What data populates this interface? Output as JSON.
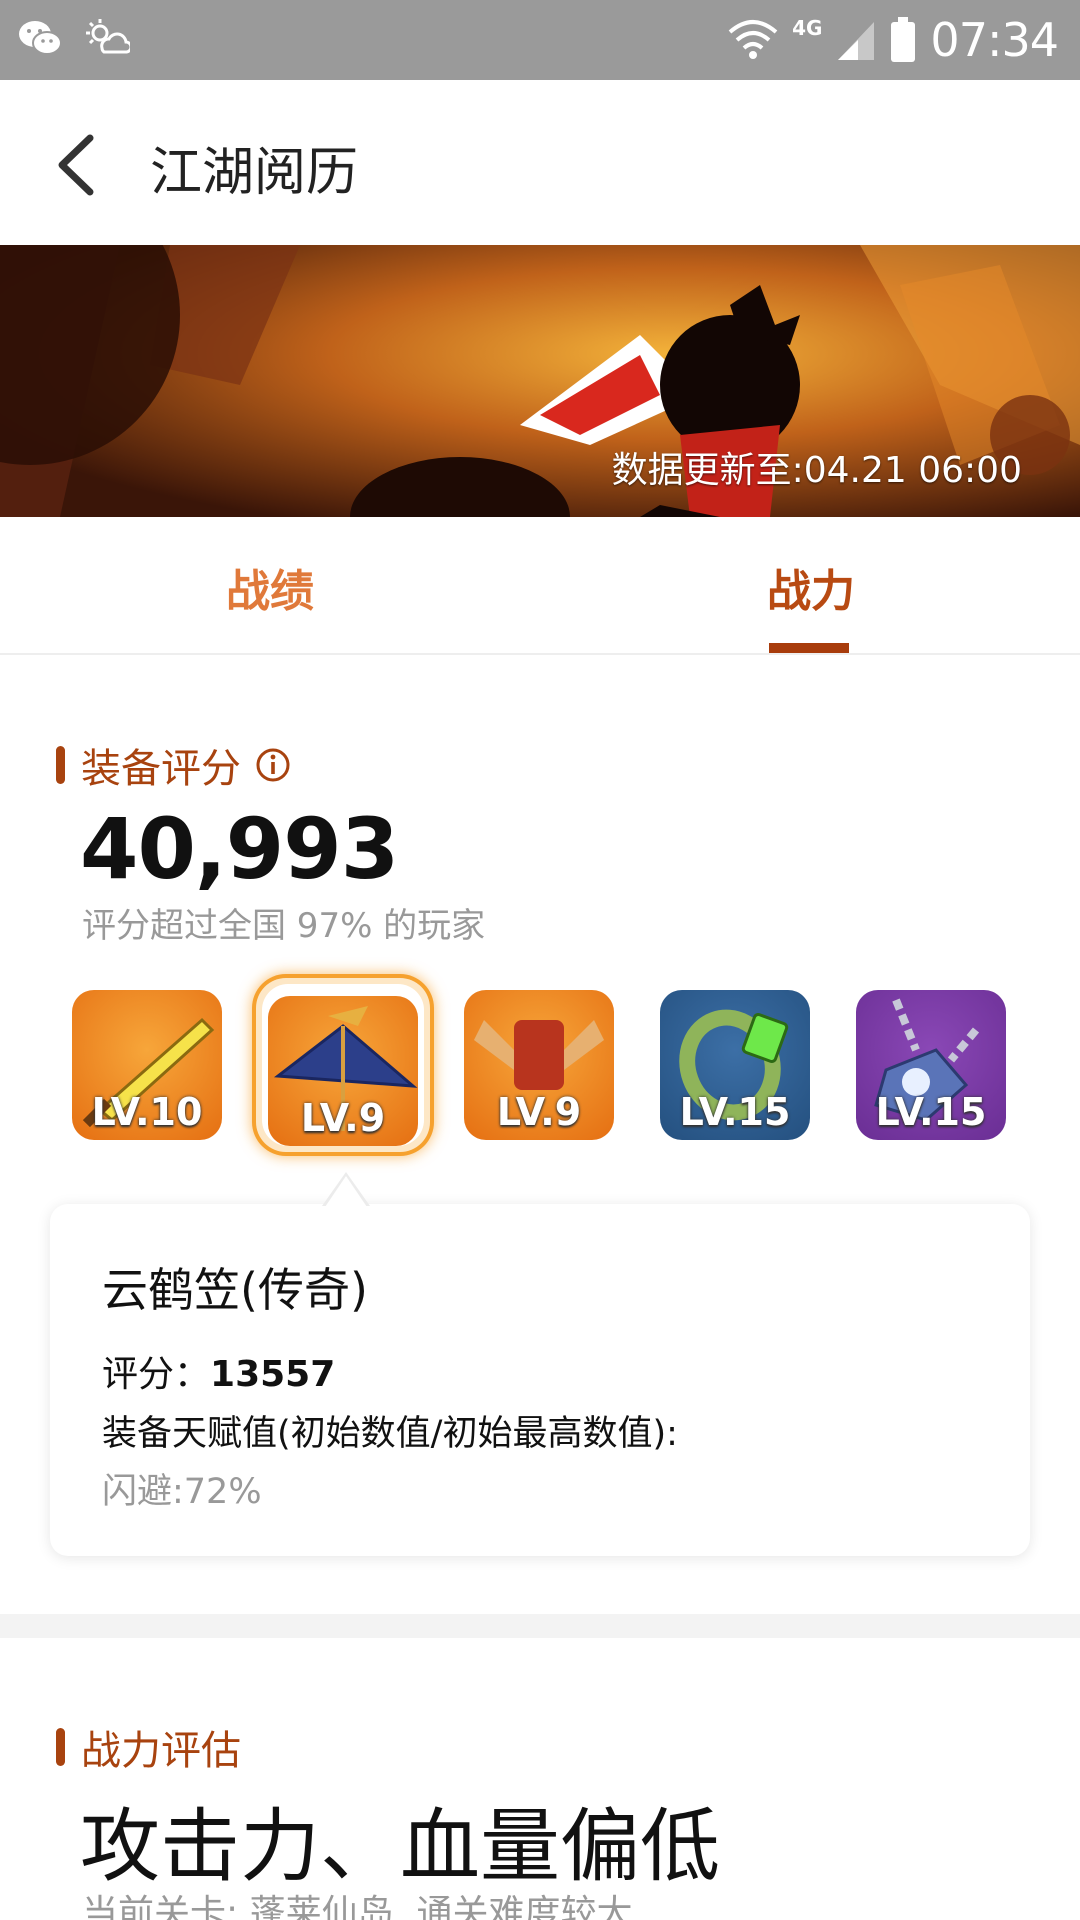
{
  "status_bar": {
    "time": "07:34",
    "network": "4G",
    "left_icons": [
      "wechat-icon",
      "weather-icon"
    ],
    "right_icons": [
      "wifi-icon",
      "signal-icon",
      "battery-icon"
    ]
  },
  "header": {
    "title": "江湖阅历",
    "back_icon": "chevron-left-icon"
  },
  "banner": {
    "update_text": "数据更新至:04.21 06:00"
  },
  "tabs": [
    {
      "label": "战绩",
      "active": false
    },
    {
      "label": "战力",
      "active": true
    }
  ],
  "equipment_section": {
    "title": "装备评分",
    "score": "40,993",
    "subtitle": "评分超过全国 97% 的玩家",
    "items": [
      {
        "level": "LV.10",
        "icon": "sword-icon",
        "color": "#ee8a22",
        "selected": false
      },
      {
        "level": "LV.9",
        "icon": "hat-icon",
        "color": "#ee8a22",
        "selected": true
      },
      {
        "level": "LV.9",
        "icon": "armor-icon",
        "color": "#ee8a22",
        "selected": false
      },
      {
        "level": "LV.15",
        "icon": "bracelet-icon",
        "color": "#2f5f94",
        "selected": false
      },
      {
        "level": "LV.15",
        "icon": "necklace-icon",
        "color": "#7a3ba6",
        "selected": false
      }
    ],
    "detail": {
      "name": "云鹤笠(传奇)",
      "score_label": "评分：",
      "score_value": "13557",
      "talent_label": "装备天赋值(初始数值/初始最高数值):",
      "stat": "闪避:72%"
    }
  },
  "assessment_section": {
    "title": "战力评估",
    "headline": "攻击力、血量偏低",
    "subtitle": "当前关卡: 蓬莱仙岛, 通关难度较大"
  },
  "colors": {
    "accent": "#a8430f",
    "tab_inactive": "#e0793a",
    "status_bar": "#9a9a9a"
  }
}
